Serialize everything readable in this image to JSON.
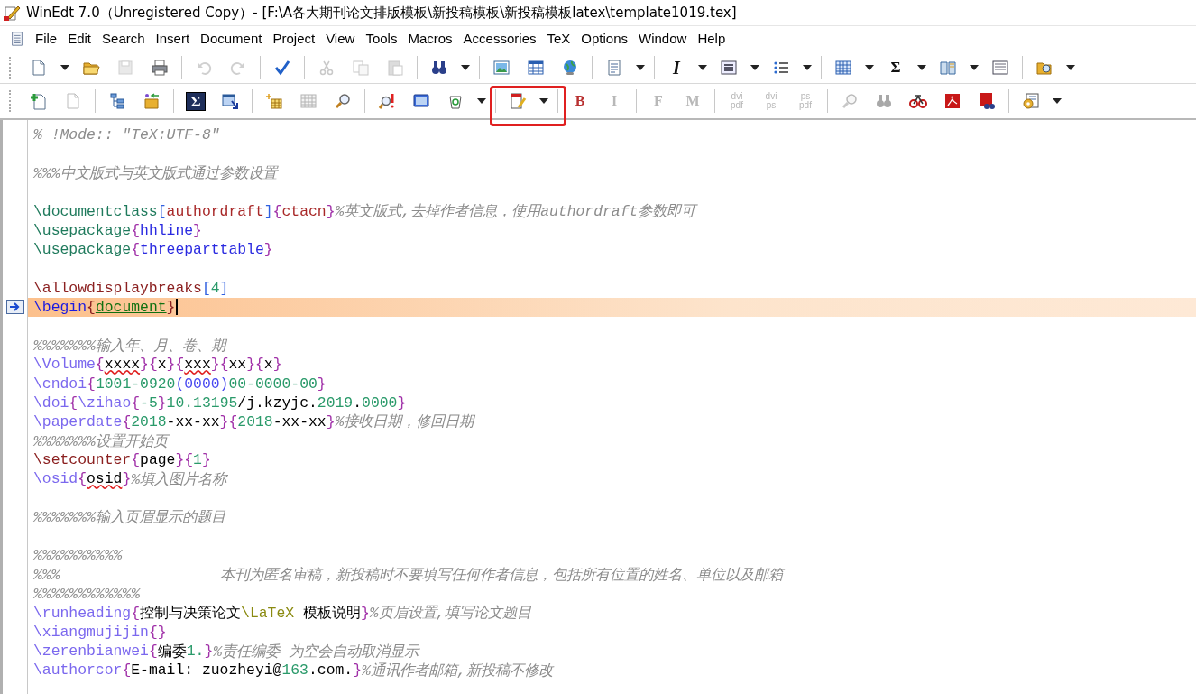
{
  "window": {
    "title": "WinEdt 7.0（Unregistered  Copy）- [F:\\A各大期刊论文排版模板\\新投稿模板\\新投稿模板latex\\template1019.tex]"
  },
  "menu": [
    {
      "label": "File"
    },
    {
      "label": "Edit"
    },
    {
      "label": "Search"
    },
    {
      "label": "Insert"
    },
    {
      "label": "Document"
    },
    {
      "label": "Project"
    },
    {
      "label": "View"
    },
    {
      "label": "Tools"
    },
    {
      "label": "Macros"
    },
    {
      "label": "Accessories"
    },
    {
      "label": "TeX"
    },
    {
      "label": "Options"
    },
    {
      "label": "Window"
    },
    {
      "label": "Help"
    }
  ],
  "toolbar_1": [
    {
      "kind": "icon",
      "disabled": false
    },
    {
      "kind": "dropdown"
    },
    {
      "kind": "icon",
      "disabled": false
    },
    {
      "kind": "icon",
      "disabled": true
    },
    {
      "kind": "icon",
      "disabled": false
    },
    {
      "kind": "separator"
    },
    {
      "kind": "icon",
      "disabled": true
    },
    {
      "kind": "icon",
      "disabled": true
    },
    {
      "kind": "separator"
    },
    {
      "kind": "icon",
      "disabled": false
    },
    {
      "kind": "separator"
    },
    {
      "kind": "icon",
      "disabled": true
    },
    {
      "kind": "icon",
      "disabled": true
    },
    {
      "kind": "icon",
      "disabled": true
    },
    {
      "kind": "separator"
    },
    {
      "kind": "icon",
      "disabled": false
    },
    {
      "kind": "dropdown"
    },
    {
      "kind": "separator"
    },
    {
      "kind": "icon",
      "disabled": false
    },
    {
      "kind": "icon",
      "disabled": false
    },
    {
      "kind": "icon",
      "disabled": false
    },
    {
      "kind": "separator"
    },
    {
      "kind": "icon",
      "disabled": false
    },
    {
      "kind": "dropdown"
    },
    {
      "kind": "separator"
    },
    {
      "kind": "italic-text",
      "label": "I",
      "disabled": false
    },
    {
      "kind": "dropdown"
    },
    {
      "kind": "icon",
      "disabled": false
    },
    {
      "kind": "dropdown"
    },
    {
      "kind": "icon",
      "disabled": false
    },
    {
      "kind": "dropdown"
    },
    {
      "kind": "separator"
    },
    {
      "kind": "icon",
      "disabled": false
    },
    {
      "kind": "dropdown"
    },
    {
      "kind": "text",
      "label": "Σ",
      "disabled": false
    },
    {
      "kind": "dropdown"
    },
    {
      "kind": "icon",
      "disabled": false
    },
    {
      "kind": "dropdown"
    },
    {
      "kind": "icon",
      "disabled": false
    },
    {
      "kind": "separator"
    },
    {
      "kind": "icon",
      "disabled": false
    },
    {
      "kind": "dropdown"
    }
  ],
  "toolbar_2": [
    {
      "kind": "icon",
      "disabled": false
    },
    {
      "kind": "icon",
      "disabled": true
    },
    {
      "kind": "separator"
    },
    {
      "kind": "icon",
      "disabled": false
    },
    {
      "kind": "icon",
      "disabled": false
    },
    {
      "kind": "separator"
    },
    {
      "kind": "boxed-text",
      "label": "Σ",
      "disabled": false
    },
    {
      "kind": "icon",
      "disabled": false
    },
    {
      "kind": "separator"
    },
    {
      "kind": "icon",
      "disabled": false
    },
    {
      "kind": "icon",
      "disabled": true
    },
    {
      "kind": "icon",
      "disabled": false
    },
    {
      "kind": "separator"
    },
    {
      "kind": "icon",
      "disabled": false
    },
    {
      "kind": "icon",
      "disabled": false
    },
    {
      "kind": "icon",
      "disabled": false
    },
    {
      "kind": "dropdown"
    },
    {
      "kind": "separator"
    },
    {
      "kind": "icon",
      "disabled": false
    },
    {
      "kind": "dropdown"
    },
    {
      "kind": "separator"
    },
    {
      "kind": "format",
      "label": "B",
      "disabled": false
    },
    {
      "kind": "format",
      "label": "I",
      "disabled": true
    },
    {
      "kind": "separator"
    },
    {
      "kind": "format",
      "label": "F",
      "disabled": true
    },
    {
      "kind": "format",
      "label": "M",
      "disabled": true
    },
    {
      "kind": "separator"
    },
    {
      "kind": "conversion",
      "label": "dvi",
      "sub": "pdf",
      "disabled": true
    },
    {
      "kind": "conversion",
      "label": "dvi",
      "sub": "ps",
      "disabled": true
    },
    {
      "kind": "conversion",
      "label": "ps",
      "sub": "pdf",
      "disabled": true
    },
    {
      "kind": "separator"
    },
    {
      "kind": "icon",
      "disabled": true
    },
    {
      "kind": "icon",
      "disabled": true
    },
    {
      "kind": "icon",
      "disabled": false
    },
    {
      "kind": "icon",
      "disabled": false
    },
    {
      "kind": "icon",
      "disabled": false
    },
    {
      "kind": "separator"
    },
    {
      "kind": "icon",
      "disabled": false
    },
    {
      "kind": "dropdown"
    }
  ],
  "editor": {
    "lines": [
      {
        "current": false,
        "segments": [
          {
            "kind": "comment",
            "text": "% !Mode:: \"TeX:UTF-8\""
          }
        ]
      },
      {
        "current": false
      },
      {
        "current": false,
        "segments": [
          {
            "kind": "comment",
            "text": "%%%中文版式与英文版式通过参数设置"
          }
        ]
      },
      {
        "current": false
      },
      {
        "current": false,
        "segments": [
          {
            "kind": "cmd-green",
            "text": "\\documentclass"
          },
          {
            "kind": "bracket",
            "text": "["
          },
          {
            "kind": "option",
            "text": "authordraft"
          },
          {
            "kind": "bracket",
            "text": "]"
          },
          {
            "kind": "brace",
            "text": "{"
          },
          {
            "kind": "option",
            "text": "ctacn"
          },
          {
            "kind": "brace",
            "text": "}"
          },
          {
            "kind": "comment",
            "text": "%英文版式,去掉作者信息，使用authordraft参数即可"
          }
        ]
      },
      {
        "current": false,
        "segments": [
          {
            "kind": "cmd-green",
            "text": "\\usepackage"
          },
          {
            "kind": "brace",
            "text": "{"
          },
          {
            "kind": "package",
            "text": "hhline"
          },
          {
            "kind": "brace",
            "text": "}"
          }
        ]
      },
      {
        "current": false,
        "segments": [
          {
            "kind": "cmd-green",
            "text": "\\usepackage"
          },
          {
            "kind": "brace",
            "text": "{"
          },
          {
            "kind": "package",
            "text": "threeparttable"
          },
          {
            "kind": "brace",
            "text": "}"
          }
        ]
      },
      {
        "current": false
      },
      {
        "current": false,
        "segments": [
          {
            "kind": "cmd-red",
            "text": "\\allowdisplaybreaks"
          },
          {
            "kind": "bracket",
            "text": "["
          },
          {
            "kind": "number",
            "text": "4"
          },
          {
            "kind": "bracket",
            "text": "]"
          }
        ]
      },
      {
        "current": true,
        "segments": [
          {
            "kind": "cmd-blue",
            "text": "\\begin"
          },
          {
            "kind": "brace-red",
            "text": "{"
          },
          {
            "kind": "environment",
            "text": "document"
          },
          {
            "kind": "brace-red",
            "text": "}"
          }
        ]
      },
      {
        "current": false
      },
      {
        "current": false,
        "segments": [
          {
            "kind": "comment",
            "text": "%%%%%%%输入年、月、卷、期"
          }
        ]
      },
      {
        "current": false,
        "segments": [
          {
            "kind": "cmd-violet",
            "text": "\\Volume"
          },
          {
            "kind": "brace",
            "text": "{"
          },
          {
            "kind": "misspelled",
            "text": "xxxx"
          },
          {
            "kind": "brace",
            "text": "}{"
          },
          {
            "kind": "plain",
            "text": "x"
          },
          {
            "kind": "brace",
            "text": "}{"
          },
          {
            "kind": "misspelled",
            "text": "xxx"
          },
          {
            "kind": "brace",
            "text": "}{"
          },
          {
            "kind": "plain",
            "text": "xx"
          },
          {
            "kind": "brace",
            "text": "}{"
          },
          {
            "kind": "plain",
            "text": "x"
          },
          {
            "kind": "brace",
            "text": "}"
          }
        ]
      },
      {
        "current": false,
        "segments": [
          {
            "kind": "cmd-violet",
            "text": "\\cndoi"
          },
          {
            "kind": "brace",
            "text": "{"
          },
          {
            "kind": "number",
            "text": "1001-0920"
          },
          {
            "kind": "paren",
            "text": "(0000)"
          },
          {
            "kind": "number",
            "text": "00-0000-00"
          },
          {
            "kind": "brace",
            "text": "}"
          }
        ]
      },
      {
        "current": false,
        "segments": [
          {
            "kind": "cmd-violet",
            "text": "\\doi"
          },
          {
            "kind": "brace",
            "text": "{"
          },
          {
            "kind": "cmd-violet",
            "text": "\\zihao"
          },
          {
            "kind": "brace",
            "text": "{"
          },
          {
            "kind": "number",
            "text": "-5"
          },
          {
            "kind": "brace",
            "text": "}"
          },
          {
            "kind": "number",
            "text": "10.13195"
          },
          {
            "kind": "plain",
            "text": "/j.kzyjc."
          },
          {
            "kind": "number",
            "text": "2019"
          },
          {
            "kind": "plain",
            "text": "."
          },
          {
            "kind": "number",
            "text": "0000"
          },
          {
            "kind": "brace",
            "text": "}"
          }
        ]
      },
      {
        "current": false,
        "segments": [
          {
            "kind": "cmd-violet",
            "text": "\\paperdate"
          },
          {
            "kind": "brace",
            "text": "{"
          },
          {
            "kind": "number",
            "text": "2018"
          },
          {
            "kind": "plain",
            "text": "-xx-xx"
          },
          {
            "kind": "brace",
            "text": "}{"
          },
          {
            "kind": "number",
            "text": "2018"
          },
          {
            "kind": "plain",
            "text": "-xx-xx"
          },
          {
            "kind": "brace",
            "text": "}"
          },
          {
            "kind": "comment",
            "text": "%接收日期，修回日期"
          }
        ]
      },
      {
        "current": false,
        "segments": [
          {
            "kind": "comment",
            "text": "%%%%%%%设置开始页"
          }
        ]
      },
      {
        "current": false,
        "segments": [
          {
            "kind": "cmd-red",
            "text": "\\setcounter"
          },
          {
            "kind": "brace",
            "text": "{"
          },
          {
            "kind": "plain",
            "text": "page"
          },
          {
            "kind": "brace",
            "text": "}{"
          },
          {
            "kind": "number",
            "text": "1"
          },
          {
            "kind": "brace",
            "text": "}"
          }
        ]
      },
      {
        "current": false,
        "segments": [
          {
            "kind": "cmd-violet",
            "text": "\\osid"
          },
          {
            "kind": "brace",
            "text": "{"
          },
          {
            "kind": "misspelled",
            "text": "osid"
          },
          {
            "kind": "brace",
            "text": "}"
          },
          {
            "kind": "comment",
            "text": "%填入图片名称"
          }
        ]
      },
      {
        "current": false
      },
      {
        "current": false,
        "segments": [
          {
            "kind": "comment",
            "text": "%%%%%%%输入页眉显示的题目"
          }
        ]
      },
      {
        "current": false
      },
      {
        "current": false,
        "segments": [
          {
            "kind": "comment",
            "text": "%%%%%%%%%%"
          }
        ]
      },
      {
        "current": false,
        "segments": [
          {
            "kind": "comment",
            "text": "%%%                  本刊为匿名审稿，新投稿时不要填写任何作者信息，包括所有位置的姓名、单位以及邮箱"
          }
        ]
      },
      {
        "current": false,
        "segments": [
          {
            "kind": "comment",
            "text": "%%%%%%%%%%%%"
          }
        ]
      },
      {
        "current": false,
        "segments": [
          {
            "kind": "cmd-violet",
            "text": "\\runheading"
          },
          {
            "kind": "brace",
            "text": "{"
          },
          {
            "kind": "plain",
            "text": "控制与决策论文"
          },
          {
            "kind": "latex",
            "text": "\\LaTeX"
          },
          {
            "kind": "plain",
            "text": " 模板说明"
          },
          {
            "kind": "brace",
            "text": "}"
          },
          {
            "kind": "comment",
            "text": "%页眉设置,填写论文题目"
          }
        ]
      },
      {
        "current": false,
        "segments": [
          {
            "kind": "cmd-violet",
            "text": "\\xiangmujijin"
          },
          {
            "kind": "brace",
            "text": "{}"
          }
        ]
      },
      {
        "current": false,
        "segments": [
          {
            "kind": "cmd-violet",
            "text": "\\zerenbianwei"
          },
          {
            "kind": "brace",
            "text": "{"
          },
          {
            "kind": "plain",
            "text": "编委"
          },
          {
            "kind": "number",
            "text": "1."
          },
          {
            "kind": "brace",
            "text": "}"
          },
          {
            "kind": "comment",
            "text": "%责任编委 为空会自动取消显示"
          }
        ]
      },
      {
        "current": false,
        "segments": [
          {
            "kind": "cmd-violet",
            "text": "\\authorcor"
          },
          {
            "kind": "brace",
            "text": "{"
          },
          {
            "kind": "plain",
            "text": "E-mail: zuozheyi@"
          },
          {
            "kind": "number",
            "text": "163"
          },
          {
            "kind": "plain",
            "text": ".com."
          },
          {
            "kind": "brace",
            "text": "}"
          },
          {
            "kind": "comment",
            "text": "%通讯作者邮箱,新投稿不修改"
          }
        ]
      }
    ]
  }
}
